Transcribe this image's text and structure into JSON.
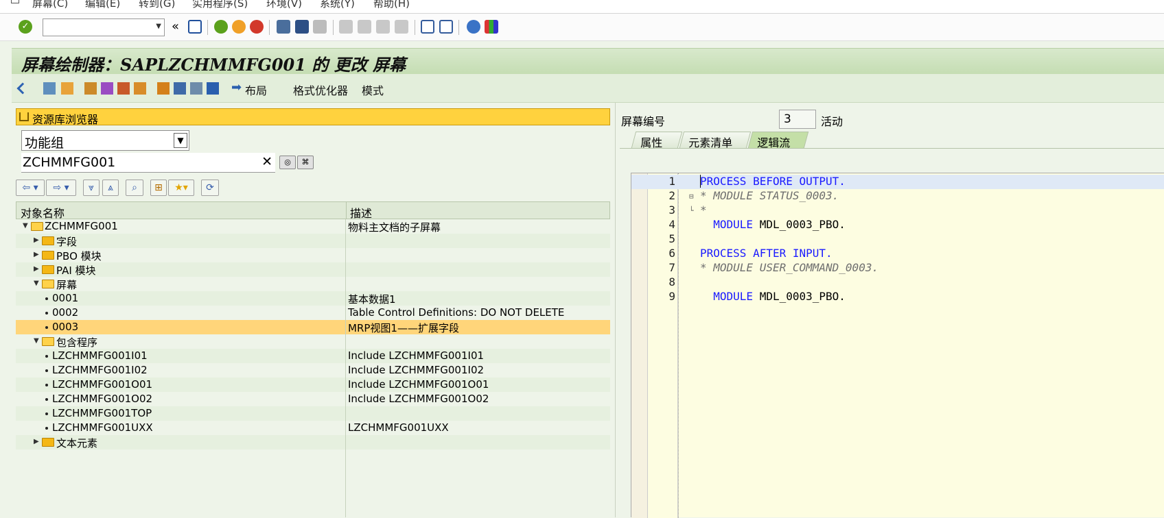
{
  "menubar": {
    "items": [
      "屏幕(C)",
      "编辑(E)",
      "转到(G)",
      "实用程序(S)",
      "环境(V)",
      "系统(Y)",
      "帮助(H)"
    ]
  },
  "toolbar": {
    "command_field": "",
    "back_glyph": "«"
  },
  "title": "屏幕绘制器：SAPLZCHMMFG001 的 更改 屏幕",
  "app_toolbar": {
    "layout_label": "布局",
    "format_label": "格式优化器",
    "mode_label": "模式"
  },
  "repo": {
    "header": "资源库浏览器",
    "object_type": "功能组",
    "object_name": "ZCHMMFG001",
    "clear_glyph": "✕"
  },
  "tree": {
    "col_name": "对象名称",
    "col_desc": "描述",
    "rows": [
      {
        "name": "ZCHMMFG001",
        "desc": "物料主文档的子屏幕"
      },
      {
        "name": "字段",
        "desc": ""
      },
      {
        "name": "PBO 模块",
        "desc": ""
      },
      {
        "name": "PAI 模块",
        "desc": ""
      },
      {
        "name": "屏幕",
        "desc": ""
      },
      {
        "name": "0001",
        "desc": "基本数据1"
      },
      {
        "name": "0002",
        "desc": "Table Control Definitions: DO NOT DELETE"
      },
      {
        "name": "0003",
        "desc": "MRP视图1——扩展字段"
      },
      {
        "name": "包含程序",
        "desc": ""
      },
      {
        "name": "LZCHMMFG001I01",
        "desc": "Include LZCHMMFG001I01"
      },
      {
        "name": "LZCHMMFG001I02",
        "desc": "Include LZCHMMFG001I02"
      },
      {
        "name": "LZCHMMFG001O01",
        "desc": "Include LZCHMMFG001O01"
      },
      {
        "name": "LZCHMMFG001O02",
        "desc": "Include LZCHMMFG001O02"
      },
      {
        "name": "LZCHMMFG001TOP",
        "desc": ""
      },
      {
        "name": "LZCHMMFG001UXX",
        "desc": "LZCHMMFG001UXX"
      },
      {
        "name": "文本元素",
        "desc": ""
      }
    ]
  },
  "screen": {
    "number_label": "屏幕编号",
    "number_value": "3",
    "status": "活动"
  },
  "tabs": [
    "属性",
    "元素清单",
    "逻辑流"
  ],
  "editor": {
    "line_numbers": [
      "1",
      "2",
      "3",
      "4",
      "5",
      "6",
      "7",
      "8",
      "9"
    ],
    "lines": [
      "PROCESS BEFORE OUTPUT.",
      "* MODULE STATUS_0003.",
      "*",
      "  MODULE MDL_0003_PBO.",
      "",
      "PROCESS AFTER INPUT.",
      "* MODULE USER_COMMAND_0003.",
      "",
      "  MODULE MDL_0003_PBO."
    ]
  },
  "colors": {
    "keyword": "#1a1aff",
    "comment": "#6e6e6e",
    "selection": "#ffd57a",
    "header_yellow": "#ffd23e",
    "active_tab": "#c4dfa7"
  }
}
